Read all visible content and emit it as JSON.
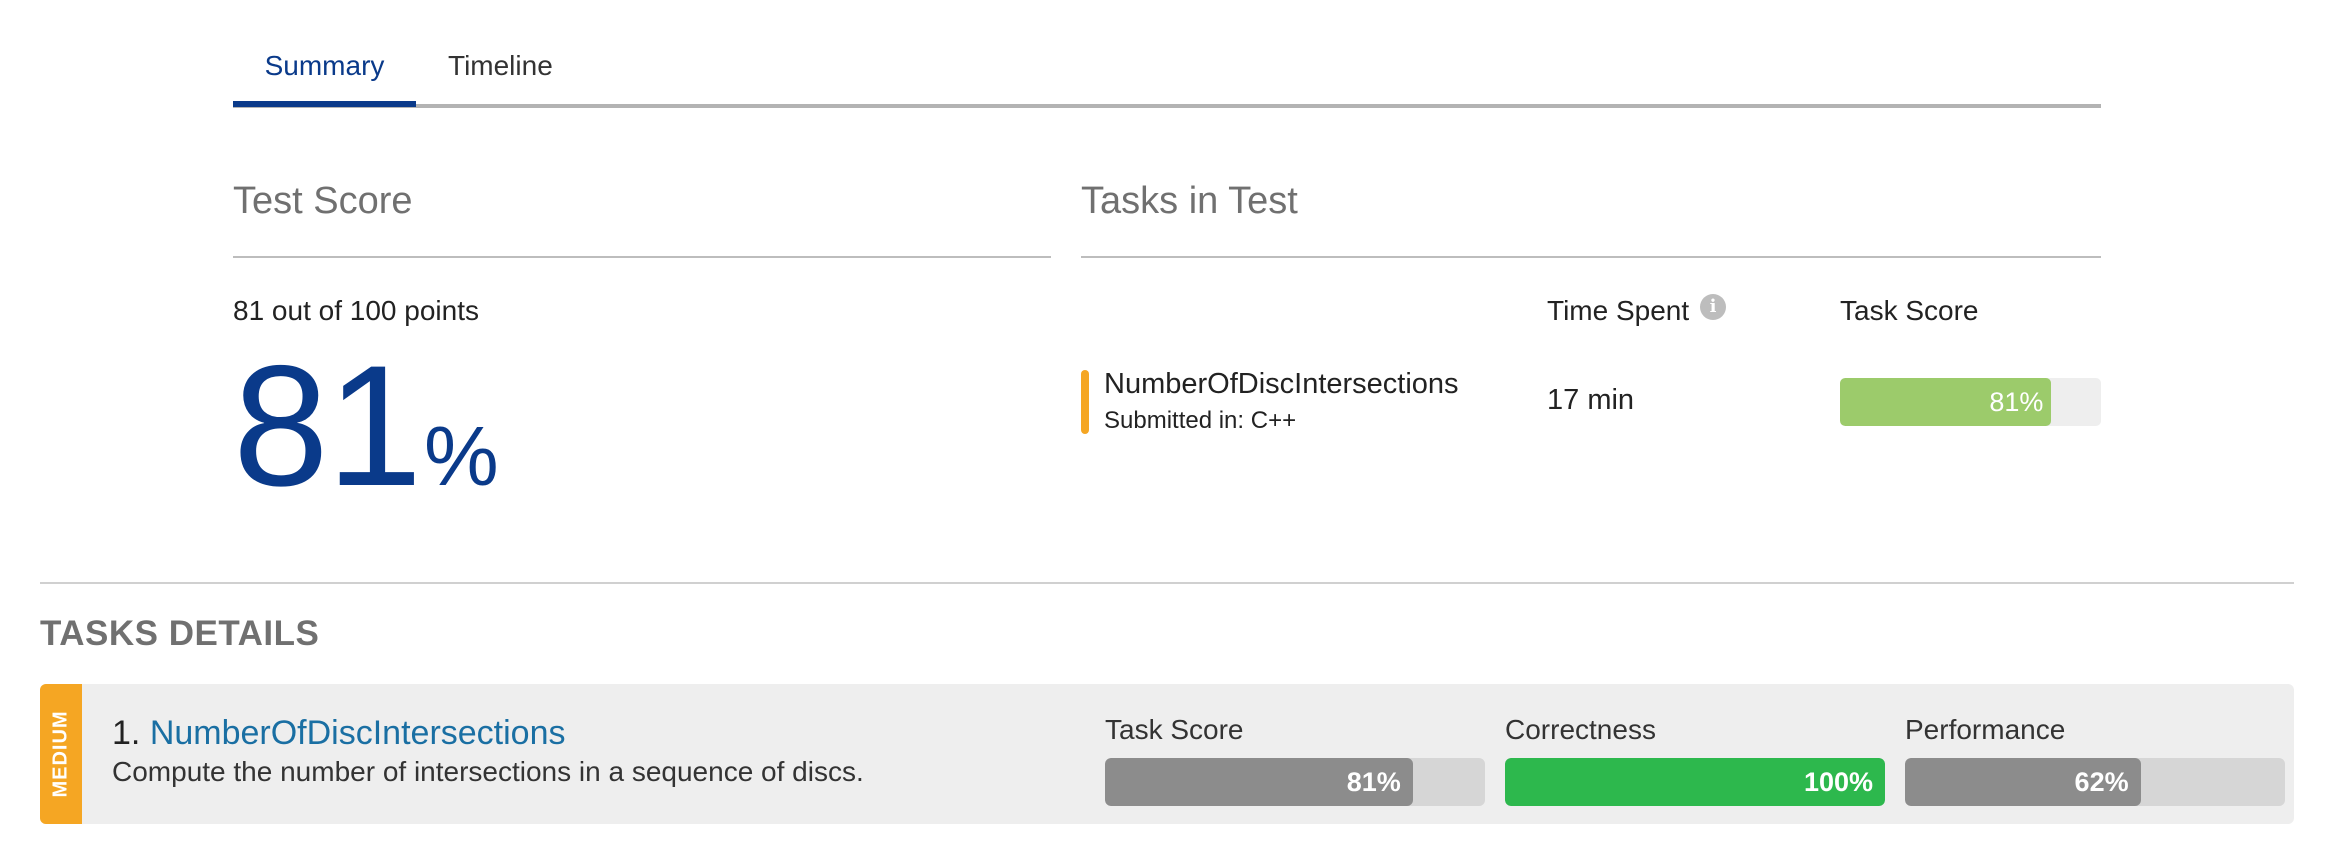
{
  "tabs": [
    {
      "label": "Summary",
      "active": true
    },
    {
      "label": "Timeline",
      "active": false
    }
  ],
  "test_score": {
    "heading": "Test Score",
    "points_text": "81 out of 100 points",
    "percent_value": "81",
    "percent_sign": "%"
  },
  "tasks_in_test": {
    "heading": "Tasks in Test",
    "columns": {
      "time_spent": "Time Spent",
      "task_score": "Task Score"
    },
    "info_icon": "info-icon",
    "rows": [
      {
        "name": "NumberOfDiscIntersections",
        "submitted": "Submitted in: C++",
        "time_spent": "17 min",
        "score_label": "81%",
        "score_fraction": 0.81,
        "accent_color": "#f5a623",
        "bar_color": "#9ccb6b"
      }
    ]
  },
  "tasks_details": {
    "heading": "TASKS DETAILS",
    "tasks": [
      {
        "difficulty": "MEDIUM",
        "difficulty_color": "#f5a623",
        "number": "1.",
        "name": "NumberOfDiscIntersections",
        "description": "Compute the number of intersections in a sequence of discs.",
        "metrics": [
          {
            "label": "Task Score",
            "value_label": "81%",
            "fraction": 0.81,
            "color": "#8c8c8c"
          },
          {
            "label": "Correctness",
            "value_label": "100%",
            "fraction": 1.0,
            "color": "#2db84d"
          },
          {
            "label": "Performance",
            "value_label": "62%",
            "fraction": 0.62,
            "color": "#8c8c8c"
          }
        ]
      }
    ]
  },
  "colors": {
    "brand_blue": "#0a3a8a",
    "link_blue": "#1a6fa3",
    "medium_orange": "#f5a623"
  }
}
